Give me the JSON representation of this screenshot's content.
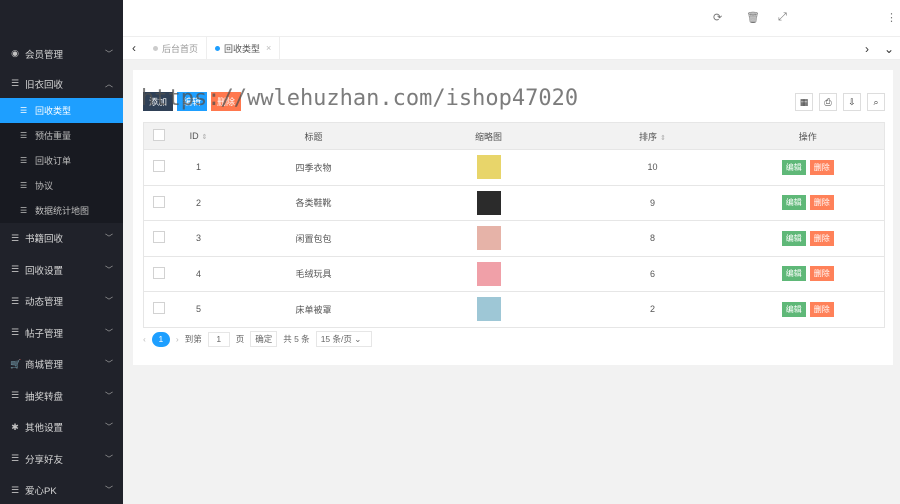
{
  "watermark": "https://wwlehuzhan.com/ishop47020",
  "topbar": {
    "icons": [
      "refresh-icon",
      "trash-icon",
      "fullscreen-icon",
      "more-icon"
    ]
  },
  "sidebar": {
    "items": [
      {
        "label": "会员管理",
        "icon": "user-circle-icon"
      },
      {
        "label": "旧衣回收",
        "icon": "list-icon",
        "open": true,
        "children": [
          {
            "label": "回收类型",
            "active": true
          },
          {
            "label": "预估重量"
          },
          {
            "label": "回收订单"
          },
          {
            "label": "协议"
          },
          {
            "label": "数据统计地图"
          }
        ]
      },
      {
        "label": "书籍回收",
        "icon": "list-icon"
      },
      {
        "label": "回收设置",
        "icon": "list-icon"
      },
      {
        "label": "动态管理",
        "icon": "list-icon"
      },
      {
        "label": "帖子管理",
        "icon": "list-icon"
      },
      {
        "label": "商城管理",
        "icon": "cart-icon"
      },
      {
        "label": "抽奖转盘",
        "icon": "list-icon"
      },
      {
        "label": "其他设置",
        "icon": "gear-icon"
      },
      {
        "label": "分享好友",
        "icon": "list-icon"
      },
      {
        "label": "爱心PK",
        "icon": "list-icon"
      }
    ]
  },
  "tabs": [
    {
      "label": "后台首页",
      "active": false
    },
    {
      "label": "回收类型",
      "active": true,
      "close": "×"
    }
  ],
  "toolbar": {
    "btn1": "添加",
    "btn2": "编辑",
    "btn3": "删除"
  },
  "table": {
    "headers": {
      "id": "ID",
      "title": "标题",
      "thumb": "缩略图",
      "sort": "排序",
      "action": "操作"
    },
    "rows": [
      {
        "id": "1",
        "title": "四季衣物",
        "sort": "10",
        "thumb_color": "#e8d56a"
      },
      {
        "id": "2",
        "title": "各类鞋靴",
        "sort": "9",
        "thumb_color": "#2b2b2b"
      },
      {
        "id": "3",
        "title": "闲置包包",
        "sort": "8",
        "thumb_color": "#e6b3a8"
      },
      {
        "id": "4",
        "title": "毛绒玩具",
        "sort": "6",
        "thumb_color": "#f0a0a8"
      },
      {
        "id": "5",
        "title": "床单被罩",
        "sort": "2",
        "thumb_color": "#9ec7d6"
      }
    ],
    "edit_label": "编辑",
    "delete_label": "删除"
  },
  "pager": {
    "current": "1",
    "goto_label": "到第",
    "page_input": "1",
    "page_unit": "页",
    "confirm": "确定",
    "total": "共 5 条",
    "page_size": "15 条/页"
  }
}
